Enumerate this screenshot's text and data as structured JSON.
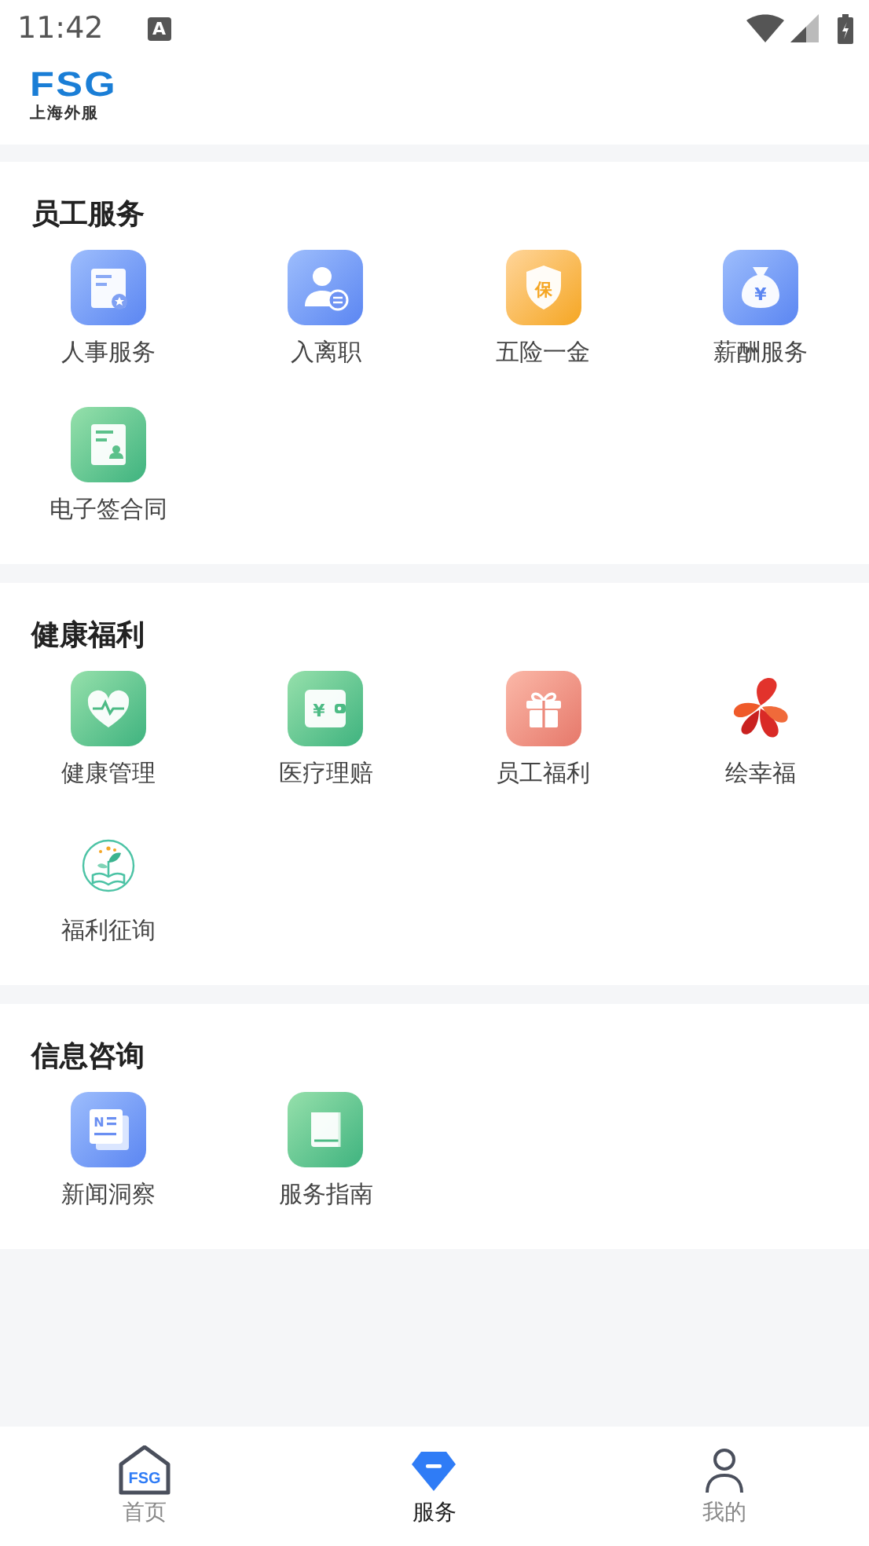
{
  "status_bar": {
    "time": "11:42",
    "notification_badge": "A"
  },
  "header": {
    "logo_mark": "FSG",
    "logo_caption": "上海外服"
  },
  "sections": [
    {
      "title": "员工服务",
      "items": [
        {
          "label": "人事服务",
          "kind": "document"
        },
        {
          "label": "入离职",
          "kind": "person"
        },
        {
          "label": "五险一金",
          "kind": "shield",
          "icon_text": "保"
        },
        {
          "label": "薪酬服务",
          "kind": "moneybag",
          "icon_text": "¥"
        },
        {
          "label": "电子签合同",
          "kind": "contract"
        }
      ]
    },
    {
      "title": "健康福利",
      "items": [
        {
          "label": "健康管理",
          "kind": "heart"
        },
        {
          "label": "医疗理赔",
          "kind": "wallet",
          "icon_text": "¥"
        },
        {
          "label": "员工福利",
          "kind": "gift"
        },
        {
          "label": "绘幸福",
          "kind": "ribbon"
        },
        {
          "label": "福利征询",
          "kind": "sprout"
        }
      ]
    },
    {
      "title": "信息咨询",
      "items": [
        {
          "label": "新闻洞察",
          "kind": "news",
          "icon_text": "N"
        },
        {
          "label": "服务指南",
          "kind": "book"
        }
      ]
    }
  ],
  "tabs": [
    {
      "label": "首页",
      "kind": "home",
      "icon_text": "FSG",
      "selected": false
    },
    {
      "label": "服务",
      "kind": "service",
      "selected": true
    },
    {
      "label": "我的",
      "kind": "profile",
      "selected": false
    }
  ]
}
